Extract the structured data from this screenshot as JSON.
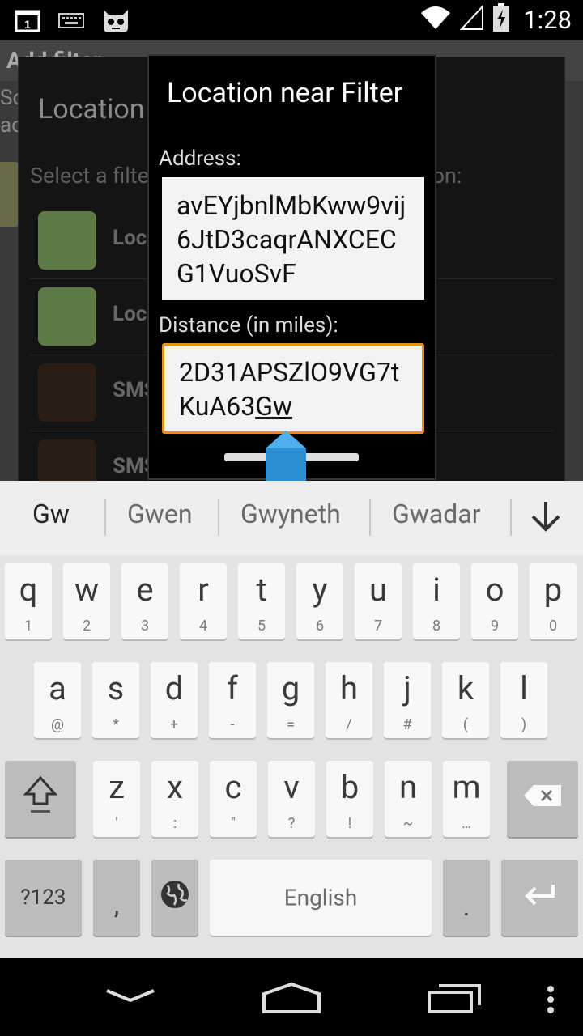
{
  "status_bar": {
    "time": "1:28",
    "icons": [
      "notification-one-icon",
      "keyboard-icon",
      "cyanogen-mascot-icon",
      "wifi-icon",
      "signal-icon",
      "battery-charging-icon"
    ]
  },
  "background": {
    "app_title": "Add filter",
    "side_text_1": "So",
    "side_text_2": "ac",
    "dialog_title": "Location",
    "instruction": "Select a filter to add to [Location]: ... filter on:",
    "rows": [
      {
        "label": "Location near",
        "color": "#5e7b46"
      },
      {
        "label": "Location away",
        "color": "#5e7b46"
      },
      {
        "label": "SMS",
        "color": "#2a1e14"
      },
      {
        "label": "SMS",
        "color": "#2a1e14"
      }
    ]
  },
  "dialog": {
    "title": "Location near Filter",
    "address_label": "Address:",
    "address_value": "avEYjbnlMbKww9vij6JtD3caqrANXCECG1VuoSvF",
    "distance_label": "Distance (in miles):",
    "distance_value": "2D31APSZlO9VG7tKuA63",
    "distance_composing": "Gw"
  },
  "suggestions": {
    "items": [
      "Gw",
      "Gwen",
      "Gwyneth",
      "Gwadar"
    ]
  },
  "keyboard": {
    "row1": [
      {
        "k": "q",
        "h": "1"
      },
      {
        "k": "w",
        "h": "2"
      },
      {
        "k": "e",
        "h": "3"
      },
      {
        "k": "r",
        "h": "4"
      },
      {
        "k": "t",
        "h": "5"
      },
      {
        "k": "y",
        "h": "6"
      },
      {
        "k": "u",
        "h": "7"
      },
      {
        "k": "i",
        "h": "8"
      },
      {
        "k": "o",
        "h": "9"
      },
      {
        "k": "p",
        "h": "0"
      }
    ],
    "row2": [
      {
        "k": "a",
        "h": "@"
      },
      {
        "k": "s",
        "h": "*"
      },
      {
        "k": "d",
        "h": "+"
      },
      {
        "k": "f",
        "h": "-"
      },
      {
        "k": "g",
        "h": "="
      },
      {
        "k": "h",
        "h": "/"
      },
      {
        "k": "j",
        "h": "#"
      },
      {
        "k": "k",
        "h": "("
      },
      {
        "k": "l",
        "h": ")"
      }
    ],
    "row3": [
      {
        "k": "z",
        "h": "'"
      },
      {
        "k": "x",
        "h": ":"
      },
      {
        "k": "c",
        "h": "\""
      },
      {
        "k": "v",
        "h": "?"
      },
      {
        "k": "b",
        "h": "!"
      },
      {
        "k": "n",
        "h": "~"
      },
      {
        "k": "m",
        "h": "…"
      }
    ],
    "symbols_label": "?123",
    "comma_label": ",",
    "space_label": "English",
    "period_label": "."
  }
}
